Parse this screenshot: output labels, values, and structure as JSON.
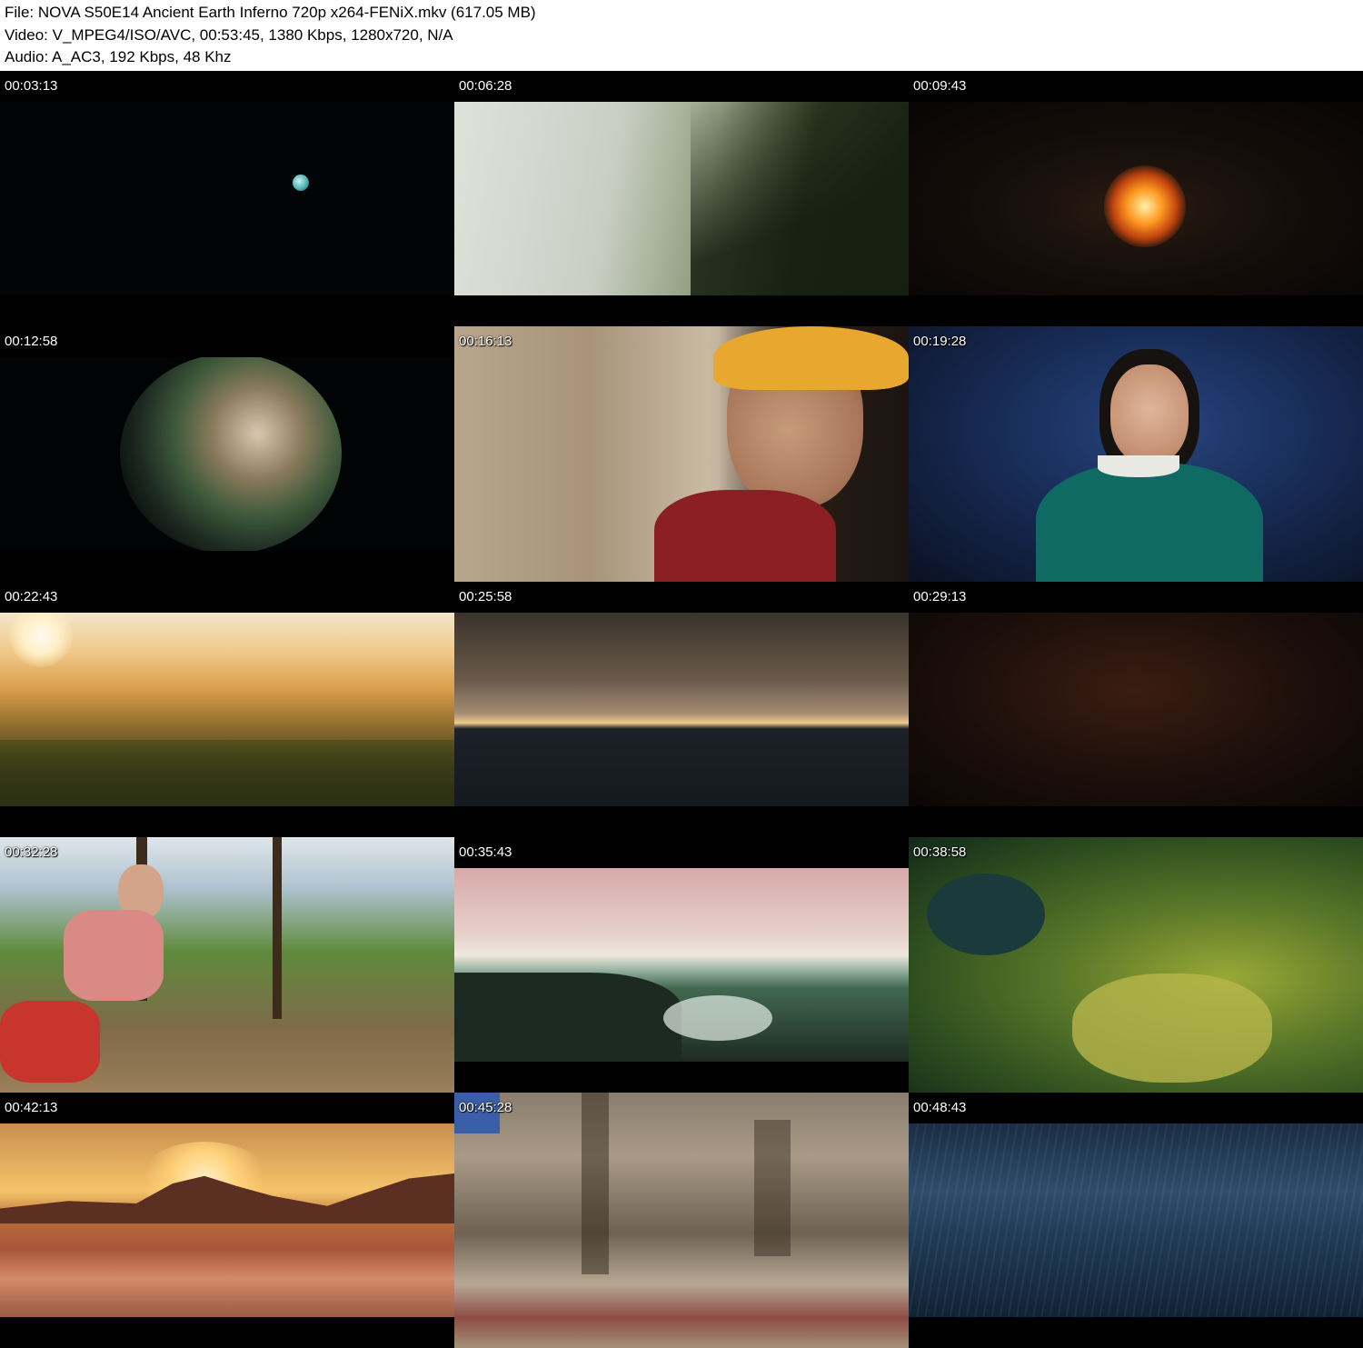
{
  "header": {
    "file_line": "File: NOVA S50E14 Ancient Earth Inferno 720p x264-FENiX.mkv (617.05 MB)",
    "video_line": "Video: V_MPEG4/ISO/AVC, 00:53:45, 1380 Kbps, 1280x720, N/A",
    "audio_line": "Audio: A_AC3, 192 Kbps, 48 Khz"
  },
  "thumbnails": [
    {
      "time": "00:03:13",
      "scene": "earth-from-space-icon"
    },
    {
      "time": "00:06:28",
      "scene": "foggy-forest-icon"
    },
    {
      "time": "00:09:43",
      "scene": "fire-icon"
    },
    {
      "time": "00:12:58",
      "scene": "planet-icon"
    },
    {
      "time": "00:16:13",
      "scene": "climber-icon"
    },
    {
      "time": "00:19:28",
      "scene": "interview-icon"
    },
    {
      "time": "00:22:43",
      "scene": "sunrise-forest-icon"
    },
    {
      "time": "00:25:58",
      "scene": "earth-horizon-icon"
    },
    {
      "time": "00:29:13",
      "scene": "dark-rock-icon"
    },
    {
      "time": "00:32:28",
      "scene": "hiker-icon"
    },
    {
      "time": "00:35:43",
      "scene": "ocean-icon"
    },
    {
      "time": "00:38:58",
      "scene": "aerial-forest-icon"
    },
    {
      "time": "00:42:13",
      "scene": "desert-icon"
    },
    {
      "time": "00:45:28",
      "scene": "cliff-icon"
    },
    {
      "time": "00:48:43",
      "scene": "storm-icon"
    }
  ]
}
